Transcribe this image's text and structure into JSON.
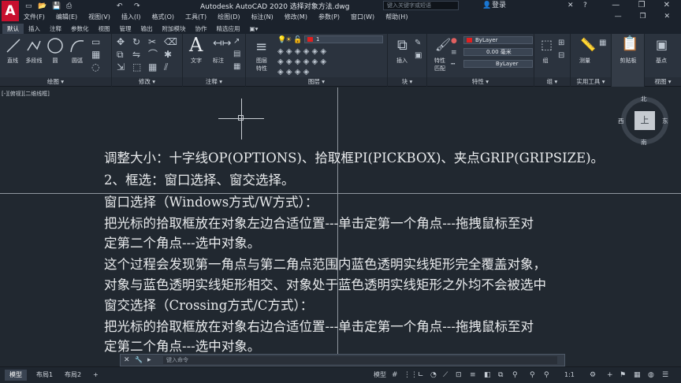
{
  "app": {
    "logo_letter": "A",
    "title": "Autodesk AutoCAD 2020    选择对象方法.dwg",
    "search_placeholder": "键入关键字或短语",
    "login": "登录",
    "window_controls": "— ❐ ✕",
    "menu_controls": "— ❐ ✕",
    "quick_access": [
      "▭",
      "📂",
      "💾",
      "⎙",
      "↶",
      "↷"
    ]
  },
  "menubar": [
    "文件(F)",
    "编辑(E)",
    "视图(V)",
    "插入(I)",
    "格式(O)",
    "工具(T)",
    "绘图(D)",
    "标注(N)",
    "修改(M)",
    "参数(P)",
    "窗口(W)",
    "帮助(H)"
  ],
  "ribbon_tabs": [
    "默认",
    "插入",
    "注释",
    "参数化",
    "视图",
    "管理",
    "输出",
    "附加模块",
    "协作",
    "精选应用",
    "▣▾"
  ],
  "ribbon": {
    "draw": {
      "title": "绘图 ▾",
      "line": "直线",
      "polyline": "多段线",
      "circle": "圆",
      "arc": "圆弧"
    },
    "modify": {
      "title": "修改 ▾"
    },
    "annotation": {
      "title": "注释 ▾",
      "text": "文字",
      "dimension": "标注"
    },
    "layers": {
      "title": "图层 ▾",
      "layer_props": "图层",
      "layer_props2": "特性",
      "current_layer": "1"
    },
    "block": {
      "title": "块 ▾",
      "insert": "插入"
    },
    "properties": {
      "title": "特性 ▾",
      "match": "特性",
      "match2": "匹配",
      "color": "ByLayer",
      "lineweight": "0.00 毫米",
      "linetype": "ByLayer"
    },
    "groups": {
      "title": "组 ▾",
      "group": "组"
    },
    "utilities": {
      "title": "实用工具 ▾",
      "measure": "测量"
    },
    "clipboard": {
      "title": "剪贴板",
      "paste": "剪贴板"
    },
    "view": {
      "title": "视图 ▾",
      "base": "基点"
    }
  },
  "viewport": {
    "label": "[-][俯视][二维线框]",
    "viewcube": {
      "north": "北",
      "south": "南",
      "east": "东",
      "west": "西",
      "top": "上"
    }
  },
  "content_lines": [
    "调整大小：十字线OP(OPTIONS)、拾取框PI(PICKBOX)、夹点GRIP(GRIPSIZE)。",
    "2、框选：窗口选择、窗交选择。",
    "窗口选择（Windows方式/W方式）：",
    "把光标的拾取框放在对象左边合适位置---单击定第一个角点---拖拽鼠标至对",
    "定第二个角点---选中对象。",
    "这个过程会发现第一角点与第二角点范围内蓝色透明实线矩形完全覆盖对象，",
    "对象与蓝色透明实线矩形相交、对象处于蓝色透明实线矩形之外均不会被选中",
    "窗交选择（Crossing方式/C方式）：",
    "把光标的拾取框放在对象右边合适位置---单击定第一个角点---拖拽鼠标至对",
    "定第二个角点---选中对象。"
  ],
  "command": {
    "placeholder": "键入命令",
    "close": "✕",
    "settings": "🔧",
    "arrow": "▸"
  },
  "layout_tabs": [
    "模型",
    "布局1",
    "布局2",
    "+"
  ],
  "statusbar": {
    "model": "模型",
    "grid": "#",
    "scale": "1:1",
    "gear": "⚙",
    "plus": "+"
  }
}
